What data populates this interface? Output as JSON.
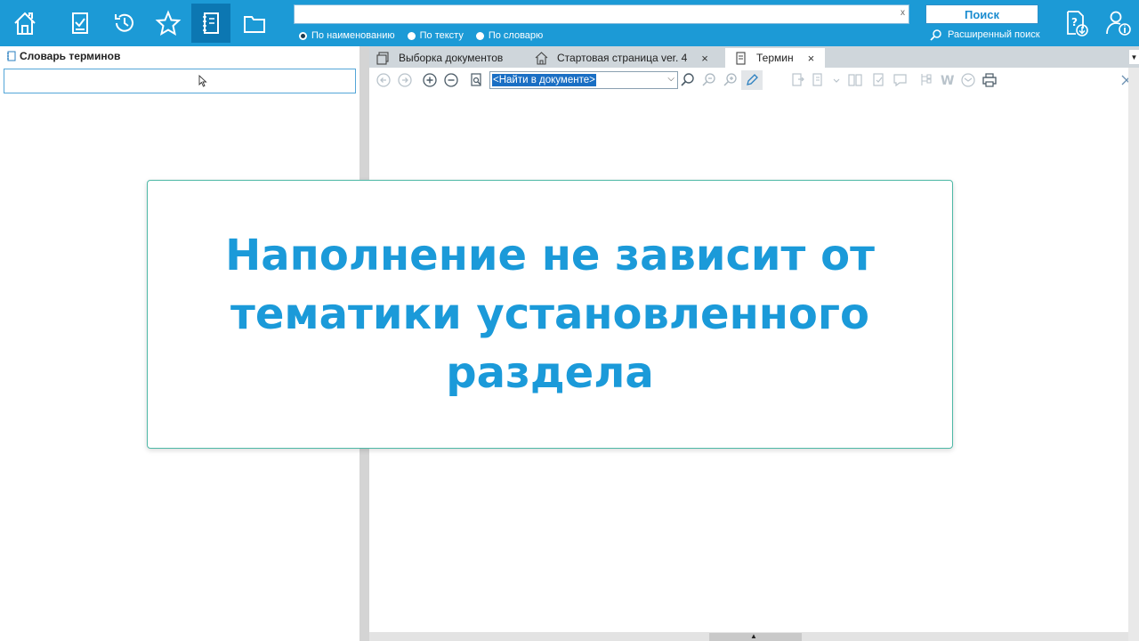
{
  "topbar": {
    "nav": [
      {
        "name": "home-icon"
      },
      {
        "name": "checklist-icon"
      },
      {
        "name": "history-icon"
      },
      {
        "name": "star-icon"
      },
      {
        "name": "dictionary-icon",
        "active": true
      },
      {
        "name": "folder-icon"
      }
    ],
    "search": {
      "value": "",
      "clear": "x",
      "options": [
        {
          "label": "По наименованию",
          "selected": true
        },
        {
          "label": "По тексту",
          "selected": false
        },
        {
          "label": "По словарю",
          "selected": false
        }
      ],
      "button": "Поиск",
      "advanced": "Расширенный поиск"
    }
  },
  "left_panel": {
    "title": "Словарь терминов",
    "input_value": ""
  },
  "tabs": [
    {
      "label": "Выборка документов",
      "icon": "documents-icon",
      "closable": false
    },
    {
      "label": "Стартовая страница ver. 4",
      "icon": "home-icon",
      "closable": true
    },
    {
      "label": "Термин",
      "icon": "document-icon",
      "closable": true,
      "active": true
    }
  ],
  "tab_close": "×",
  "toolbar": {
    "find_placeholder": "<Найти в документе>"
  },
  "overlay": {
    "text": "Наполнение не зависит от\nтематики установленного\nраздела"
  },
  "colors": {
    "brand": "#1c9ad6",
    "overlay_text": "#1b9ad9",
    "overlay_border": "#4db8a6"
  }
}
